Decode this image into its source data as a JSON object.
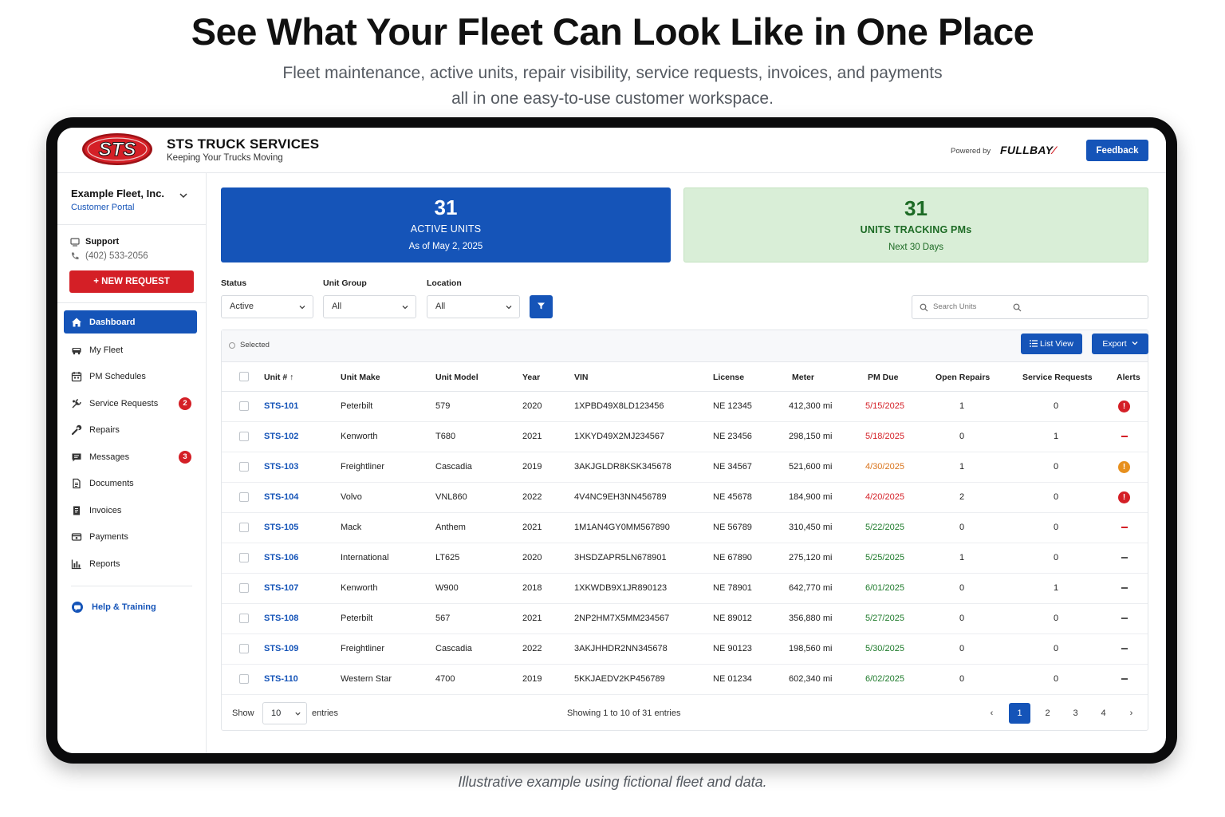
{
  "hero": {
    "title": "See What Your Fleet Can Look Like in One Place",
    "subtitle_line1": "Fleet maintenance, active units, repair visibility, service requests, invoices, and payments",
    "subtitle_line2": "all in one easy-to-use customer workspace.",
    "caption": "Illustrative example using fictional fleet and data."
  },
  "header": {
    "logo_text": "STS",
    "brand_name": "STS TRUCK SERVICES",
    "tagline": "Keeping Your Trucks Moving",
    "powered_by": "Powered by",
    "partner": "FULLBAY",
    "feedback_label": "Feedback"
  },
  "sidebar": {
    "fleet_name": "Example Fleet, Inc.",
    "portal_label": "Customer Portal",
    "support_label": "Support",
    "support_phone": "(402) 533-2056",
    "new_request_label": "+ NEW REQUEST",
    "items": [
      {
        "label": "Dashboard",
        "icon": "home-icon",
        "badge": ""
      },
      {
        "label": "My Fleet",
        "icon": "truck-icon",
        "badge": ""
      },
      {
        "label": "PM Schedules",
        "icon": "calendar-icon",
        "badge": ""
      },
      {
        "label": "Service Requests",
        "icon": "service-icon",
        "badge": "2"
      },
      {
        "label": "Repairs",
        "icon": "wrench-icon",
        "badge": ""
      },
      {
        "label": "Messages",
        "icon": "message-icon",
        "badge": "3"
      },
      {
        "label": "Documents",
        "icon": "document-icon",
        "badge": ""
      },
      {
        "label": "Invoices",
        "icon": "invoice-icon",
        "badge": ""
      },
      {
        "label": "Payments",
        "icon": "payment-icon",
        "badge": ""
      },
      {
        "label": "Reports",
        "icon": "chart-icon",
        "badge": ""
      }
    ],
    "help_label": "Help & Training"
  },
  "stats": {
    "active_units": {
      "value": "31",
      "label": "ACTIVE UNITS",
      "sub": "As of May 2, 2025"
    },
    "pm_tracking": {
      "value": "31",
      "label": "UNITS TRACKING PMs",
      "sub": "Next 30 Days"
    }
  },
  "filters": {
    "status_label": "Status",
    "status_value": "Active",
    "group_label": "Unit Group",
    "group_value": "All",
    "location_label": "Location",
    "location_value": "All",
    "search_placeholder": "Search Units"
  },
  "toolbar": {
    "selected_label": "Selected",
    "list_view_label": "List View",
    "export_label": "Export"
  },
  "table": {
    "columns": [
      "Unit #",
      "Unit Make",
      "Unit Model",
      "Year",
      "VIN",
      "License",
      "Meter",
      "PM Due",
      "Open Repairs",
      "Service Requests",
      "Alerts"
    ],
    "rows": [
      {
        "unit": "STS-101",
        "make": "Peterbilt",
        "model": "579",
        "year": "2020",
        "vin": "1XPBD49X8LD123456",
        "license": "NE 12345",
        "meter": "412,300 mi",
        "pm_due": "5/15/2025",
        "pm_status": "red",
        "open_repairs": "1",
        "service_requests": "0",
        "alert": "red-icon"
      },
      {
        "unit": "STS-102",
        "make": "Kenworth",
        "model": "T680",
        "year": "2021",
        "vin": "1XKYD49X2MJ234567",
        "license": "NE 23456",
        "meter": "298,150 mi",
        "pm_due": "5/18/2025",
        "pm_status": "red",
        "open_repairs": "0",
        "service_requests": "1",
        "alert": "red-dash"
      },
      {
        "unit": "STS-103",
        "make": "Freightliner",
        "model": "Cascadia",
        "year": "2019",
        "vin": "3AKJGLDR8KSK345678",
        "license": "NE 34567",
        "meter": "521,600 mi",
        "pm_due": "4/30/2025",
        "pm_status": "orange",
        "open_repairs": "1",
        "service_requests": "0",
        "alert": "orange-icon"
      },
      {
        "unit": "STS-104",
        "make": "Volvo",
        "model": "VNL860",
        "year": "2022",
        "vin": "4V4NC9EH3NN456789",
        "license": "NE 45678",
        "meter": "184,900 mi",
        "pm_due": "4/20/2025",
        "pm_status": "red",
        "open_repairs": "2",
        "service_requests": "0",
        "alert": "red-icon"
      },
      {
        "unit": "STS-105",
        "make": "Mack",
        "model": "Anthem",
        "year": "2021",
        "vin": "1M1AN4GY0MM567890",
        "license": "NE 56789",
        "meter": "310,450 mi",
        "pm_due": "5/22/2025",
        "pm_status": "green",
        "open_repairs": "0",
        "service_requests": "0",
        "alert": "red-dash"
      },
      {
        "unit": "STS-106",
        "make": "International",
        "model": "LT625",
        "year": "2020",
        "vin": "3HSDZAPR5LN678901",
        "license": "NE 67890",
        "meter": "275,120 mi",
        "pm_due": "5/25/2025",
        "pm_status": "green",
        "open_repairs": "1",
        "service_requests": "0",
        "alert": "gray-dash"
      },
      {
        "unit": "STS-107",
        "make": "Kenworth",
        "model": "W900",
        "year": "2018",
        "vin": "1XKWDB9X1JR890123",
        "license": "NE 78901",
        "meter": "642,770 mi",
        "pm_due": "6/01/2025",
        "pm_status": "green",
        "open_repairs": "0",
        "service_requests": "1",
        "alert": "gray-dash"
      },
      {
        "unit": "STS-108",
        "make": "Peterbilt",
        "model": "567",
        "year": "2021",
        "vin": "2NP2HM7X5MM234567",
        "license": "NE 89012",
        "meter": "356,880 mi",
        "pm_due": "5/27/2025",
        "pm_status": "green",
        "open_repairs": "0",
        "service_requests": "0",
        "alert": "gray-dash"
      },
      {
        "unit": "STS-109",
        "make": "Freightliner",
        "model": "Cascadia",
        "year": "2022",
        "vin": "3AKJHHDR2NN345678",
        "license": "NE 90123",
        "meter": "198,560 mi",
        "pm_due": "5/30/2025",
        "pm_status": "green",
        "open_repairs": "0",
        "service_requests": "0",
        "alert": "gray-dash"
      },
      {
        "unit": "STS-110",
        "make": "Western Star",
        "model": "4700",
        "year": "2019",
        "vin": "5KKJAEDV2KP456789",
        "license": "NE 01234",
        "meter": "602,340 mi",
        "pm_due": "6/02/2025",
        "pm_status": "green",
        "open_repairs": "0",
        "service_requests": "0",
        "alert": "gray-dash"
      }
    ]
  },
  "pagination": {
    "show_label": "Show",
    "page_size": "10",
    "entries_label": "entries",
    "summary": "Showing 1 to 10 of 31 entries",
    "prev": "‹",
    "next": "›",
    "pages": [
      "1",
      "2",
      "3",
      "4"
    ],
    "current": "1"
  },
  "colors": {
    "primary": "#1554b8",
    "danger": "#d41f26",
    "warning": "#e7901e",
    "success": "#1d7a2a",
    "success_bg": "#d9eed7"
  }
}
